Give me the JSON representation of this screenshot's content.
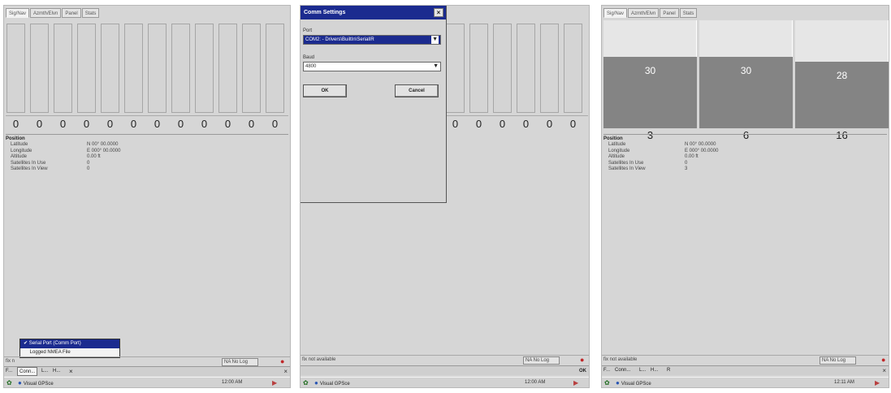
{
  "tabs": [
    "Sig/Nav",
    "Azmth/Elvn",
    "Panel",
    "Stats"
  ],
  "position": {
    "title": "Position",
    "rows": [
      {
        "label": "Latitude",
        "value": "N 00° 00.0000"
      },
      {
        "label": "Longitude",
        "value": "E 000° 00.0000"
      },
      {
        "label": "Altitude",
        "value": "0.00    ft"
      },
      {
        "label": "Satellites In Use",
        "value": "0"
      },
      {
        "label": "Satellites In View",
        "value": "0"
      }
    ]
  },
  "screen1": {
    "snr_values": [
      "0",
      "0",
      "0",
      "0",
      "0",
      "0",
      "0",
      "0",
      "0",
      "0",
      "0",
      "0"
    ],
    "status_text": "fix n",
    "log_label": "NA  No Log",
    "popup_menu": {
      "items": [
        "Serial Port (Comm Port)",
        "Logged NMEA File"
      ],
      "selected_index": 0,
      "check_mark": "✔"
    },
    "menu": [
      "F...",
      "Conn...",
      "L...",
      "H...",
      "×"
    ],
    "menu_close": "×",
    "taskbar": {
      "start_glyph": "✿",
      "app_name": "Visual GPSce",
      "time": "12:00 AM",
      "tray_glyph": "▶"
    }
  },
  "screen2": {
    "snr_values": [
      "0",
      "0",
      "0",
      "0",
      "0",
      "0"
    ],
    "dialog": {
      "title": "Comm Settings",
      "close": "×",
      "port_label": "Port",
      "port_value": "COM2: - Drivers\\BuiltIn\\SerialIR",
      "baud_label": "Baud",
      "baud_value": "4800",
      "ok_label": "OK",
      "cancel_label": "Cancel"
    },
    "status_text": "fix not available",
    "log_label": "NA  No Log",
    "ok_label": "OK",
    "taskbar": {
      "start_glyph": "✿",
      "app_name": "Visual GPSce",
      "time": "12:00 AM",
      "tray_glyph": "▶"
    }
  },
  "screen3": {
    "satellites": [
      {
        "id": "3",
        "snr": "30",
        "snr_value": 30
      },
      {
        "id": "6",
        "snr": "30",
        "snr_value": 30
      },
      {
        "id": "16",
        "snr": "28",
        "snr_value": 28
      }
    ],
    "snr_max": 50,
    "position_values": [
      "N 00° 00.0000",
      "E 000° 00.0000",
      "0.00    ft",
      "0",
      "3"
    ],
    "status_text": "fix not available",
    "log_label": "NA  No Log",
    "menu": [
      "F...",
      "Conn...",
      "L...",
      "H...",
      "R"
    ],
    "menu_close": "×",
    "taskbar": {
      "start_glyph": "✿",
      "app_name": "Visual GPSce",
      "time": "12:11 AM",
      "tray_glyph": "▶"
    }
  },
  "colors": {
    "title_bar": "#1b2b8f",
    "bar_fill": "#848484",
    "fix_dot": "#c0282a",
    "screen_bg": "#d6d6d6"
  }
}
